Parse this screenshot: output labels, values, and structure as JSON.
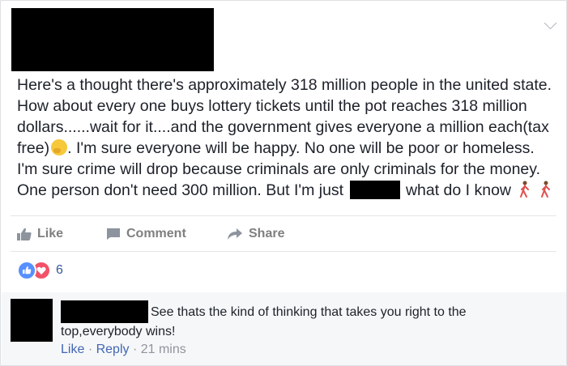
{
  "post": {
    "author_redacted": true,
    "text_lines": [
      "Here's a thought there's approximately 318 million people in the united state.",
      "How about every one buys lottery tickets until the pot reaches 318 million",
      "dollars......wait for it....and the government gives everyone a million each(tax",
      "free)",
      ". I'm sure everyone will be happy. No one will be poor or homeless.",
      "I'm sure crime will drop because criminals are only criminals for the money.",
      "One person don't need 300 million. But I'm just",
      "what do I know"
    ],
    "icons": [
      "thinking-face-emoji",
      "person-walking-emoji"
    ]
  },
  "actions": {
    "like_label": "Like",
    "comment_label": "Comment",
    "share_label": "Share"
  },
  "reactions": {
    "types": [
      "like",
      "love"
    ],
    "count": "6"
  },
  "comment": {
    "author_redacted": true,
    "text_line1": "See thats the kind of thinking that takes you right to the",
    "text_line2": "top,everybody wins!",
    "like_label": "Like",
    "separator": "·",
    "reply_label": "Reply",
    "time": "21 mins"
  },
  "colors": {
    "text": "#1d2129",
    "muted": "#7f7f7f",
    "link": "#4267b2",
    "like_blue": "#5890ff",
    "love_red": "#f25268",
    "background": "#e9ebee"
  }
}
